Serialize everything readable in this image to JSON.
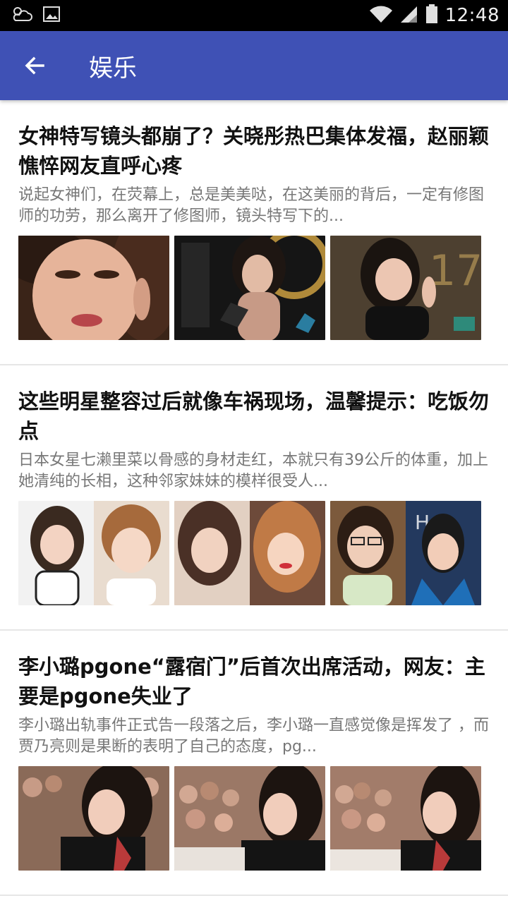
{
  "status_bar": {
    "time": "12:48",
    "icons": [
      "weather-cloud-icon",
      "image-icon",
      "wifi-icon",
      "cell-signal-icon",
      "battery-icon"
    ]
  },
  "app_bar": {
    "title": "娱乐",
    "color": "#3f51b5",
    "back_icon": "arrow-back-icon"
  },
  "articles": [
    {
      "title": "女神特写镜头都崩了？关晓彤热巴集体发福，赵丽颖憔悴网友直呼心疼",
      "summary": "说起女神们，在荧幕上，总是美美哒，在这美丽的背后，一定有修图师的功劳，那么离开了修图师，镜头特写下的...",
      "thumbnails": [
        "actress-closeup-photo",
        "actress-red-carpet-photo",
        "actress-2017-event-photo"
      ]
    },
    {
      "title": "这些明星整容过后就像车祸现场，温馨提示：吃饭勿点",
      "summary": "日本女星七濑里菜以骨感的身材走红，本就只有39公斤的体重，加上她清纯的长相，这种邻家妹妹的模样很受人...",
      "thumbnails": [
        "before-after-photo-1",
        "before-after-photo-2",
        "before-after-photo-3"
      ]
    },
    {
      "title": "李小璐pgone“露宿门”后首次出席活动，网友：主要是pgone失业了",
      "summary": "李小璐出轨事件正式告一段落之后，李小璐一直感觉像是挥发了 ，而贾乃亮则是果断的表明了自己的态度，pg...",
      "thumbnails": [
        "event-crowd-photo-1",
        "event-crowd-photo-2",
        "event-crowd-photo-3"
      ]
    }
  ]
}
